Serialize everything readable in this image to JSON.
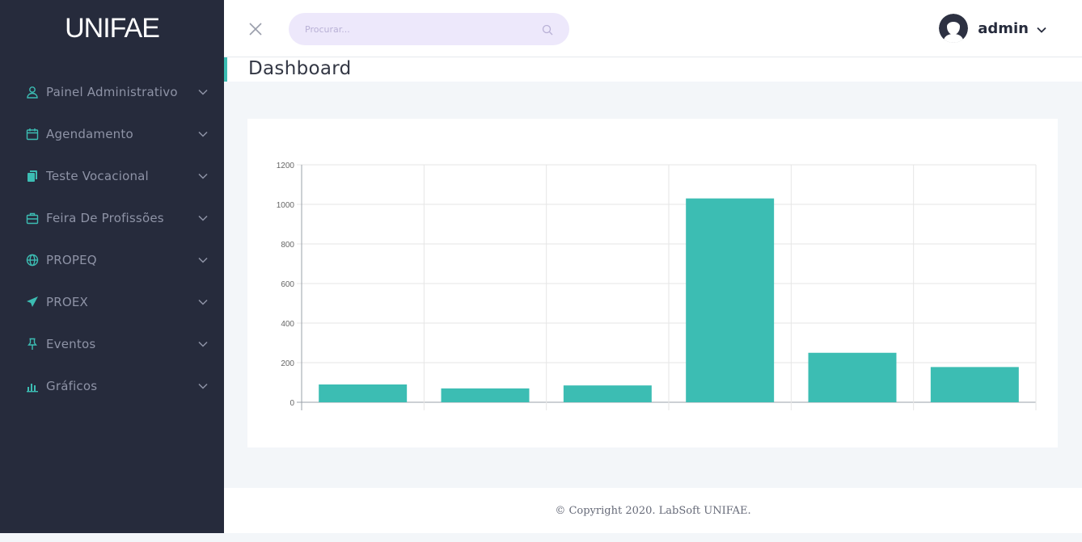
{
  "brand": {
    "logo_text": "UNIFAE"
  },
  "colors": {
    "sidebar_bg": "#262b3c",
    "accent": "#3cbdb3",
    "search_bg": "#ede8fb"
  },
  "sidebar": {
    "items": [
      {
        "label": "Painel Administrativo",
        "icon": "user-icon"
      },
      {
        "label": "Agendamento",
        "icon": "calendar-icon"
      },
      {
        "label": "Teste Vocacional",
        "icon": "copy-icon"
      },
      {
        "label": "Feira De Profissões",
        "icon": "briefcase-icon"
      },
      {
        "label": "PROPEQ",
        "icon": "globe-icon"
      },
      {
        "label": "PROEX",
        "icon": "rocket-icon"
      },
      {
        "label": "Eventos",
        "icon": "pin-icon"
      },
      {
        "label": "Gráficos",
        "icon": "bar-chart-icon"
      }
    ]
  },
  "header": {
    "search_placeholder": "Procurar...",
    "user_name": "admin"
  },
  "page": {
    "title": "Dashboard"
  },
  "chart_data": {
    "type": "bar",
    "categories": [
      "",
      "",
      "",
      "",
      "",
      ""
    ],
    "values": [
      90,
      70,
      85,
      1030,
      250,
      178
    ],
    "y_ticks": [
      "0",
      "200",
      "400",
      "600",
      "800",
      "1000",
      "1200"
    ],
    "ylim": [
      0,
      1200
    ],
    "bar_color": "#3cbdb3",
    "grid": true,
    "title": "",
    "xlabel": "",
    "ylabel": ""
  },
  "footer": {
    "copyright": "© Copyright 2020. LabSoft UNIFAE."
  }
}
